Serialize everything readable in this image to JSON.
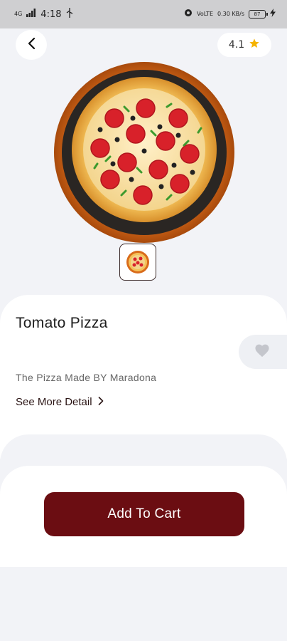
{
  "status_bar": {
    "network": "4G",
    "time": "4:18",
    "volte": "VoLTE",
    "speed": "0.30 KB/s",
    "battery": "87"
  },
  "rating": {
    "value": "4.1",
    "icon": "star-icon",
    "star_color": "#f5b301"
  },
  "product": {
    "name": "Tomato Pizza",
    "description": "The Pizza Made BY Maradona",
    "see_more": "See More Detail"
  },
  "actions": {
    "add_to_cart": "Add To Cart"
  },
  "colors": {
    "primary": "#6b0d12",
    "background": "#f2f3f7"
  }
}
